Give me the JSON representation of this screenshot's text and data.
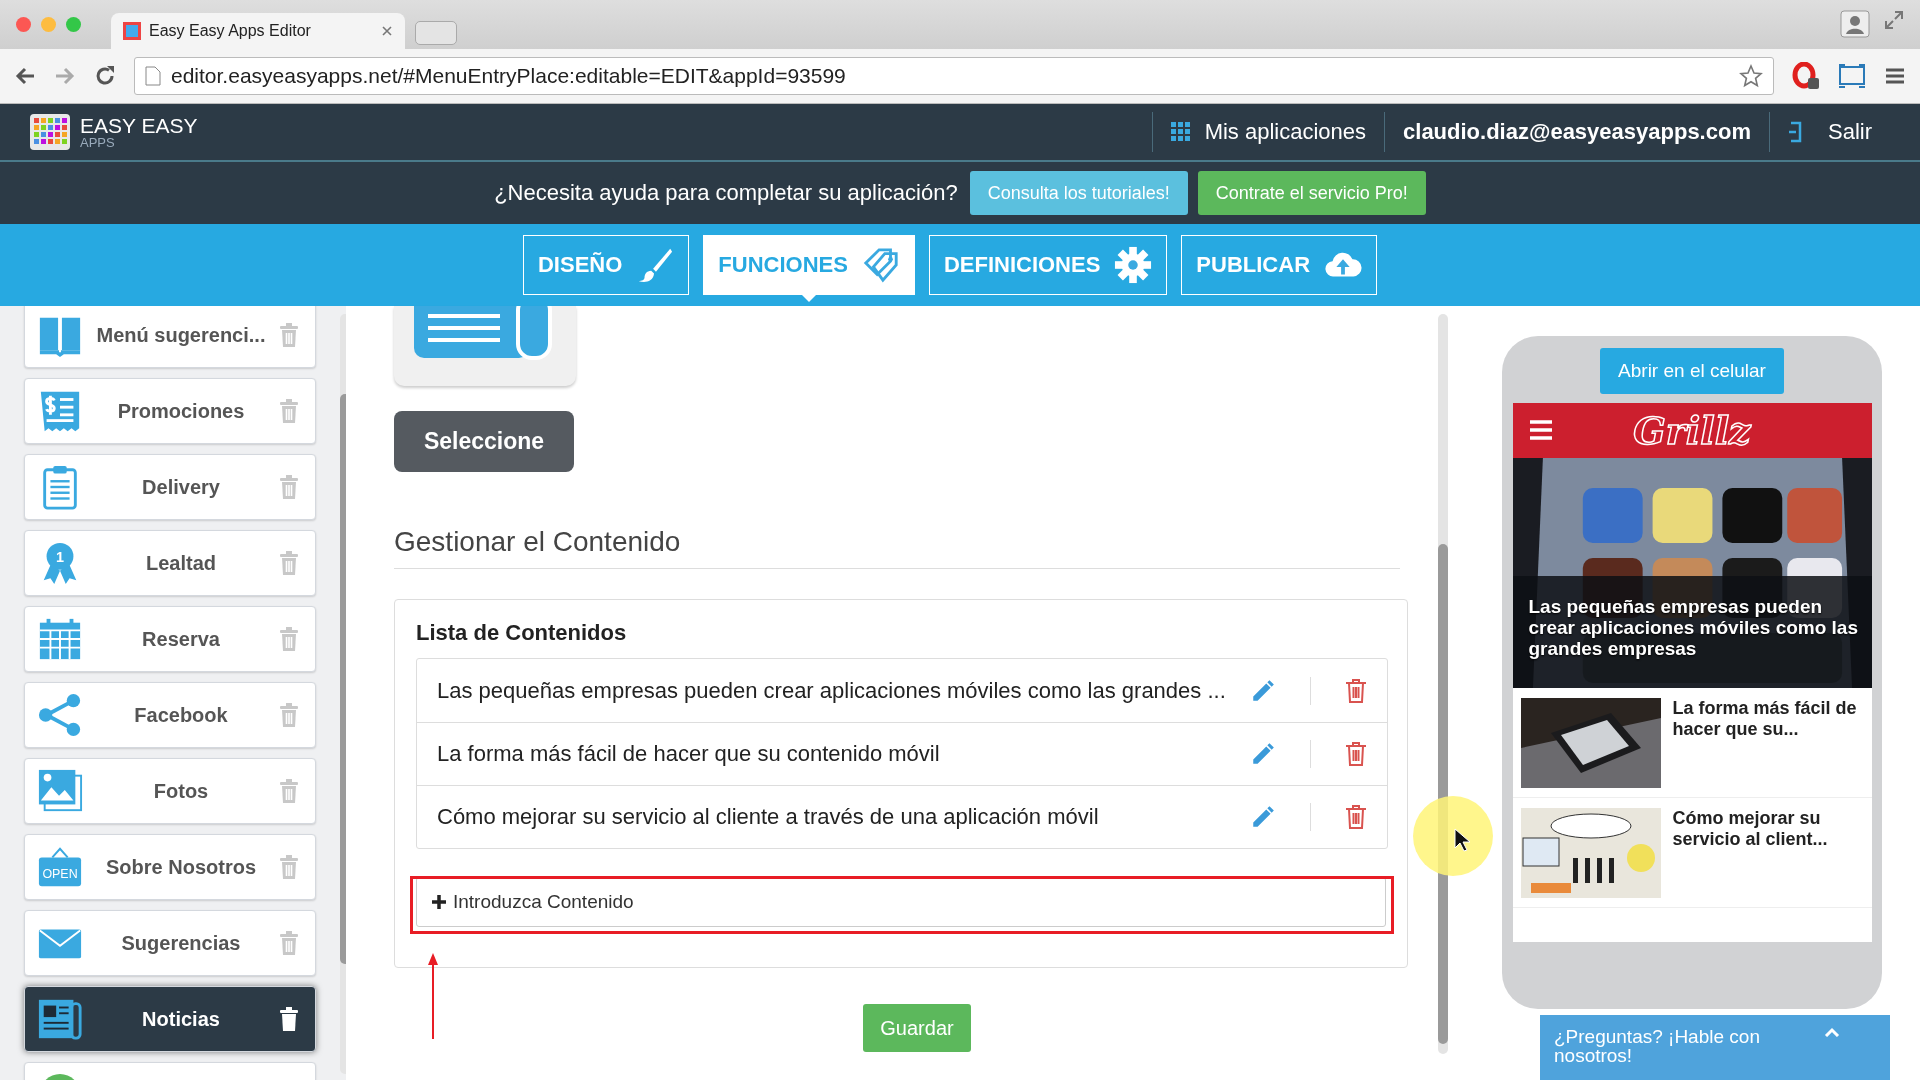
{
  "browser": {
    "tab_title": "Easy Easy Apps Editor",
    "url": "editor.easyeasyapps.net/#MenuEntryPlace:editable=EDIT&appId=93599"
  },
  "header": {
    "logo_title": "EASY EASY",
    "logo_subtitle": "APPS",
    "apps_link": "Mis aplicaciones",
    "user": "claudio.diaz@easyeasyapps.com",
    "logout": "Salir"
  },
  "help_bar": {
    "question": "¿Necesita ayuda para completar su aplicación?",
    "tutorials_button": "Consulta los tutoriales!",
    "pro_button": "Contrate el servicio Pro!"
  },
  "nav_tabs": [
    {
      "label": "DISEÑO",
      "selected": false
    },
    {
      "label": "FUNCIONES",
      "selected": true
    },
    {
      "label": "DEFINICIONES",
      "selected": false
    },
    {
      "label": "PUBLICAR",
      "selected": false
    }
  ],
  "sidebar": {
    "items": [
      {
        "label": "Menú sugerenci...",
        "selected": false
      },
      {
        "label": "Promociones",
        "selected": false
      },
      {
        "label": "Delivery",
        "selected": false
      },
      {
        "label": "Lealtad",
        "selected": false,
        "badge": "1"
      },
      {
        "label": "Reserva",
        "selected": false
      },
      {
        "label": "Facebook",
        "selected": false
      },
      {
        "label": "Fotos",
        "selected": false
      },
      {
        "label": "Sobre Nosotros",
        "selected": false,
        "badge": "OPEN"
      },
      {
        "label": "Sugerencias",
        "selected": false
      },
      {
        "label": "Noticias",
        "selected": true
      }
    ]
  },
  "content": {
    "select_button": "Seleccione",
    "section_title": "Gestionar el Contenido",
    "list_title": "Lista de Contenidos",
    "items": [
      {
        "title": "Las pequeñas empresas pueden crear aplicaciones móviles como las grandes ..."
      },
      {
        "title": "La forma más fácil de hacer que su contenido móvil"
      },
      {
        "title": "Cómo mejorar su servicio al cliente a través de una aplicación móvil"
      }
    ],
    "add_button": "Introduzca Contenido",
    "save_button": "Guardar"
  },
  "preview": {
    "open_button": "Abrir en el celular",
    "app_logo": "Grillz",
    "featured_caption": "Las pequeñas empresas pueden crear aplicaciones móviles como las grandes empresas",
    "items": [
      {
        "title": "La forma más fácil de hacer que su..."
      },
      {
        "title": "Cómo mejorar su servicio al client..."
      }
    ]
  },
  "chat": {
    "label": "¿Preguntas? ¡Hable con nosotros!"
  }
}
